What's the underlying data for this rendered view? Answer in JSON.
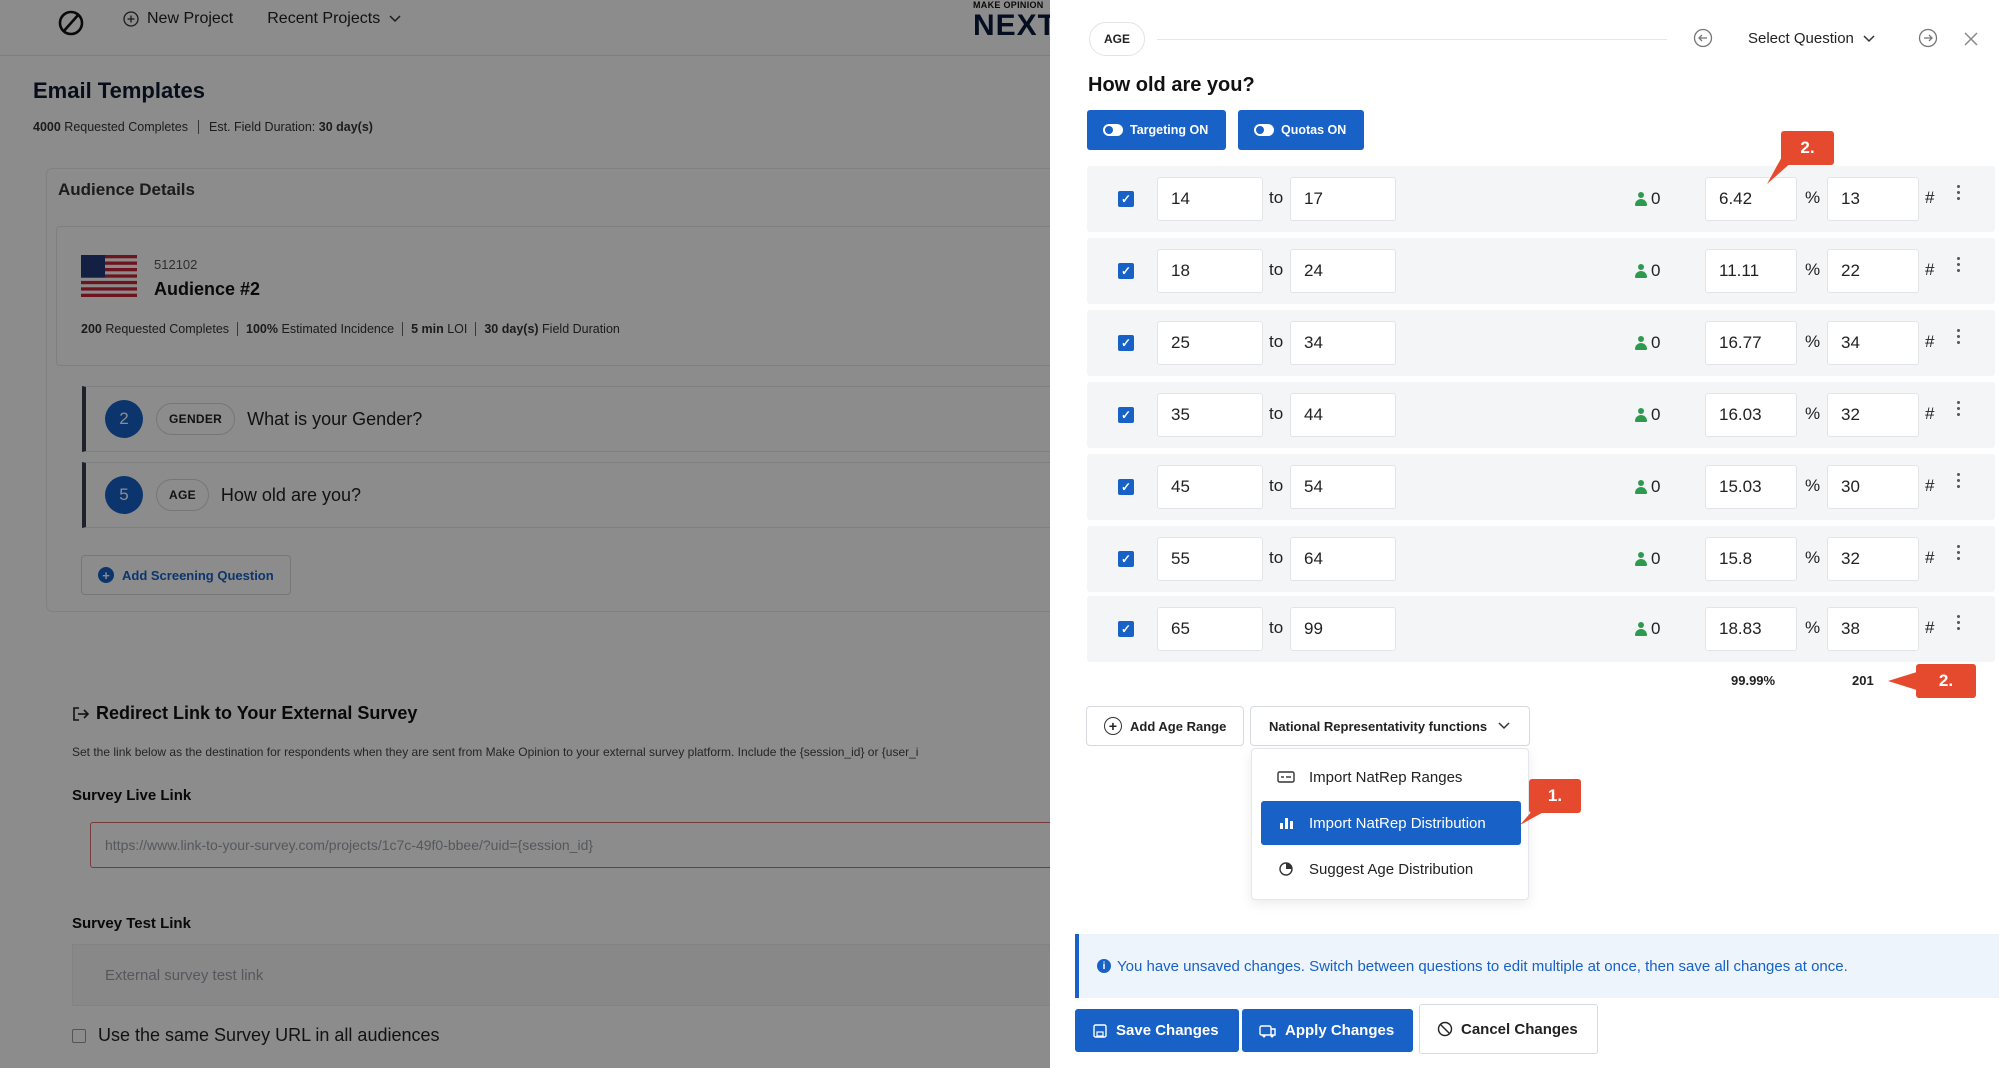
{
  "topbar": {
    "new_project": "New Project",
    "recent_projects": "Recent Projects",
    "brand_small": "MAKE OPINION",
    "brand_big": "NEXT"
  },
  "page": {
    "title": "Email Templates",
    "requested_value": "4000",
    "requested_label": "Requested Completes",
    "duration_label": "Est. Field Duration:",
    "duration_value": "30 day(s)"
  },
  "audience": {
    "section_title": "Audience Details",
    "id": "512102",
    "name": "Audience #2",
    "meta": [
      {
        "value": "200",
        "label": "Requested Completes"
      },
      {
        "value": "100%",
        "label": "Estimated Incidence"
      },
      {
        "value": "5 min",
        "label": "LOI"
      },
      {
        "value": "30 day(s)",
        "label": "Field Duration"
      }
    ],
    "questions": [
      {
        "num": "2",
        "tag": "GENDER",
        "text": "What is your Gender?"
      },
      {
        "num": "5",
        "tag": "AGE",
        "text": "How old are you?"
      }
    ],
    "add_screening": "Add Screening Question"
  },
  "redirect": {
    "title": "Redirect Link to Your External Survey",
    "desc": "Set the link below as the destination for respondents when they are sent from Make Opinion to your external survey platform. Include the {session_id} or {user_i",
    "live_label": "Survey Live Link",
    "live_placeholder": "https://www.link-to-your-survey.com/projects/1c7c-49f0-bbee/?uid={session_id}",
    "test_label": "Survey Test Link",
    "test_placeholder": "External survey test link",
    "same_url": "Use the same Survey URL in all audiences"
  },
  "panel": {
    "tag": "AGE",
    "select_question": "Select Question",
    "question": "How old are you?",
    "targeting": "Targeting ON",
    "quotas": "Quotas ON",
    "to_label": "to",
    "pct_symbol": "%",
    "num_symbol": "#",
    "rows": [
      {
        "from": "14",
        "to": "17",
        "count": "0",
        "pct": "6.42",
        "num": "13"
      },
      {
        "from": "18",
        "to": "24",
        "count": "0",
        "pct": "11.11",
        "num": "22"
      },
      {
        "from": "25",
        "to": "34",
        "count": "0",
        "pct": "16.77",
        "num": "34"
      },
      {
        "from": "35",
        "to": "44",
        "count": "0",
        "pct": "16.03",
        "num": "32"
      },
      {
        "from": "45",
        "to": "54",
        "count": "0",
        "pct": "15.03",
        "num": "30"
      },
      {
        "from": "55",
        "to": "64",
        "count": "0",
        "pct": "15.8",
        "num": "32"
      },
      {
        "from": "65",
        "to": "99",
        "count": "0",
        "pct": "18.83",
        "num": "38"
      }
    ],
    "total_pct": "99.99%",
    "total_num": "201",
    "add_age_range": "Add Age Range",
    "natrep_button": "National Representativity functions",
    "dropdown": [
      {
        "label": "Import NatRep Ranges",
        "icon": "ranges-icon"
      },
      {
        "label": "Import NatRep Distribution",
        "icon": "distribution-icon"
      },
      {
        "label": "Suggest Age Distribution",
        "icon": "suggest-icon"
      }
    ],
    "info": "You have unsaved changes. Switch between questions to edit multiple at once, then save all changes at once.",
    "save": "Save Changes",
    "apply": "Apply Changes",
    "cancel": "Cancel Changes"
  },
  "callouts": {
    "one": "1.",
    "two_top": "2.",
    "two_bottom": "2."
  },
  "colors": {
    "accent": "#1761c7",
    "callout": "#e64a2e",
    "success": "#2e9a4f"
  }
}
